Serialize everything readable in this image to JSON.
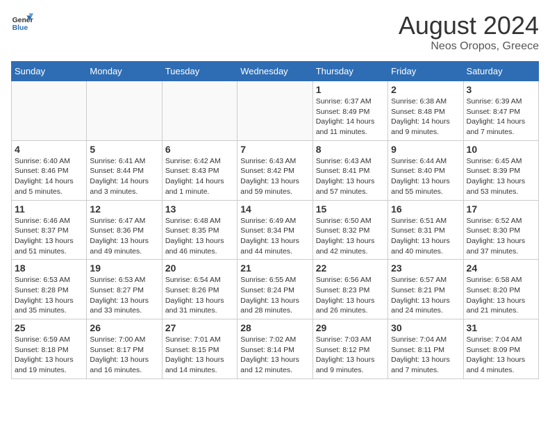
{
  "header": {
    "logo_line1": "General",
    "logo_line2": "Blue",
    "month_year": "August 2024",
    "location": "Neos Oropos, Greece"
  },
  "days_of_week": [
    "Sunday",
    "Monday",
    "Tuesday",
    "Wednesday",
    "Thursday",
    "Friday",
    "Saturday"
  ],
  "weeks": [
    [
      {
        "day": "",
        "info": ""
      },
      {
        "day": "",
        "info": ""
      },
      {
        "day": "",
        "info": ""
      },
      {
        "day": "",
        "info": ""
      },
      {
        "day": "1",
        "info": "Sunrise: 6:37 AM\nSunset: 8:49 PM\nDaylight: 14 hours\nand 11 minutes."
      },
      {
        "day": "2",
        "info": "Sunrise: 6:38 AM\nSunset: 8:48 PM\nDaylight: 14 hours\nand 9 minutes."
      },
      {
        "day": "3",
        "info": "Sunrise: 6:39 AM\nSunset: 8:47 PM\nDaylight: 14 hours\nand 7 minutes."
      }
    ],
    [
      {
        "day": "4",
        "info": "Sunrise: 6:40 AM\nSunset: 8:46 PM\nDaylight: 14 hours\nand 5 minutes."
      },
      {
        "day": "5",
        "info": "Sunrise: 6:41 AM\nSunset: 8:44 PM\nDaylight: 14 hours\nand 3 minutes."
      },
      {
        "day": "6",
        "info": "Sunrise: 6:42 AM\nSunset: 8:43 PM\nDaylight: 14 hours\nand 1 minute."
      },
      {
        "day": "7",
        "info": "Sunrise: 6:43 AM\nSunset: 8:42 PM\nDaylight: 13 hours\nand 59 minutes."
      },
      {
        "day": "8",
        "info": "Sunrise: 6:43 AM\nSunset: 8:41 PM\nDaylight: 13 hours\nand 57 minutes."
      },
      {
        "day": "9",
        "info": "Sunrise: 6:44 AM\nSunset: 8:40 PM\nDaylight: 13 hours\nand 55 minutes."
      },
      {
        "day": "10",
        "info": "Sunrise: 6:45 AM\nSunset: 8:39 PM\nDaylight: 13 hours\nand 53 minutes."
      }
    ],
    [
      {
        "day": "11",
        "info": "Sunrise: 6:46 AM\nSunset: 8:37 PM\nDaylight: 13 hours\nand 51 minutes."
      },
      {
        "day": "12",
        "info": "Sunrise: 6:47 AM\nSunset: 8:36 PM\nDaylight: 13 hours\nand 49 minutes."
      },
      {
        "day": "13",
        "info": "Sunrise: 6:48 AM\nSunset: 8:35 PM\nDaylight: 13 hours\nand 46 minutes."
      },
      {
        "day": "14",
        "info": "Sunrise: 6:49 AM\nSunset: 8:34 PM\nDaylight: 13 hours\nand 44 minutes."
      },
      {
        "day": "15",
        "info": "Sunrise: 6:50 AM\nSunset: 8:32 PM\nDaylight: 13 hours\nand 42 minutes."
      },
      {
        "day": "16",
        "info": "Sunrise: 6:51 AM\nSunset: 8:31 PM\nDaylight: 13 hours\nand 40 minutes."
      },
      {
        "day": "17",
        "info": "Sunrise: 6:52 AM\nSunset: 8:30 PM\nDaylight: 13 hours\nand 37 minutes."
      }
    ],
    [
      {
        "day": "18",
        "info": "Sunrise: 6:53 AM\nSunset: 8:28 PM\nDaylight: 13 hours\nand 35 minutes."
      },
      {
        "day": "19",
        "info": "Sunrise: 6:53 AM\nSunset: 8:27 PM\nDaylight: 13 hours\nand 33 minutes."
      },
      {
        "day": "20",
        "info": "Sunrise: 6:54 AM\nSunset: 8:26 PM\nDaylight: 13 hours\nand 31 minutes."
      },
      {
        "day": "21",
        "info": "Sunrise: 6:55 AM\nSunset: 8:24 PM\nDaylight: 13 hours\nand 28 minutes."
      },
      {
        "day": "22",
        "info": "Sunrise: 6:56 AM\nSunset: 8:23 PM\nDaylight: 13 hours\nand 26 minutes."
      },
      {
        "day": "23",
        "info": "Sunrise: 6:57 AM\nSunset: 8:21 PM\nDaylight: 13 hours\nand 24 minutes."
      },
      {
        "day": "24",
        "info": "Sunrise: 6:58 AM\nSunset: 8:20 PM\nDaylight: 13 hours\nand 21 minutes."
      }
    ],
    [
      {
        "day": "25",
        "info": "Sunrise: 6:59 AM\nSunset: 8:18 PM\nDaylight: 13 hours\nand 19 minutes."
      },
      {
        "day": "26",
        "info": "Sunrise: 7:00 AM\nSunset: 8:17 PM\nDaylight: 13 hours\nand 16 minutes."
      },
      {
        "day": "27",
        "info": "Sunrise: 7:01 AM\nSunset: 8:15 PM\nDaylight: 13 hours\nand 14 minutes."
      },
      {
        "day": "28",
        "info": "Sunrise: 7:02 AM\nSunset: 8:14 PM\nDaylight: 13 hours\nand 12 minutes."
      },
      {
        "day": "29",
        "info": "Sunrise: 7:03 AM\nSunset: 8:12 PM\nDaylight: 13 hours\nand 9 minutes."
      },
      {
        "day": "30",
        "info": "Sunrise: 7:04 AM\nSunset: 8:11 PM\nDaylight: 13 hours\nand 7 minutes."
      },
      {
        "day": "31",
        "info": "Sunrise: 7:04 AM\nSunset: 8:09 PM\nDaylight: 13 hours\nand 4 minutes."
      }
    ]
  ]
}
